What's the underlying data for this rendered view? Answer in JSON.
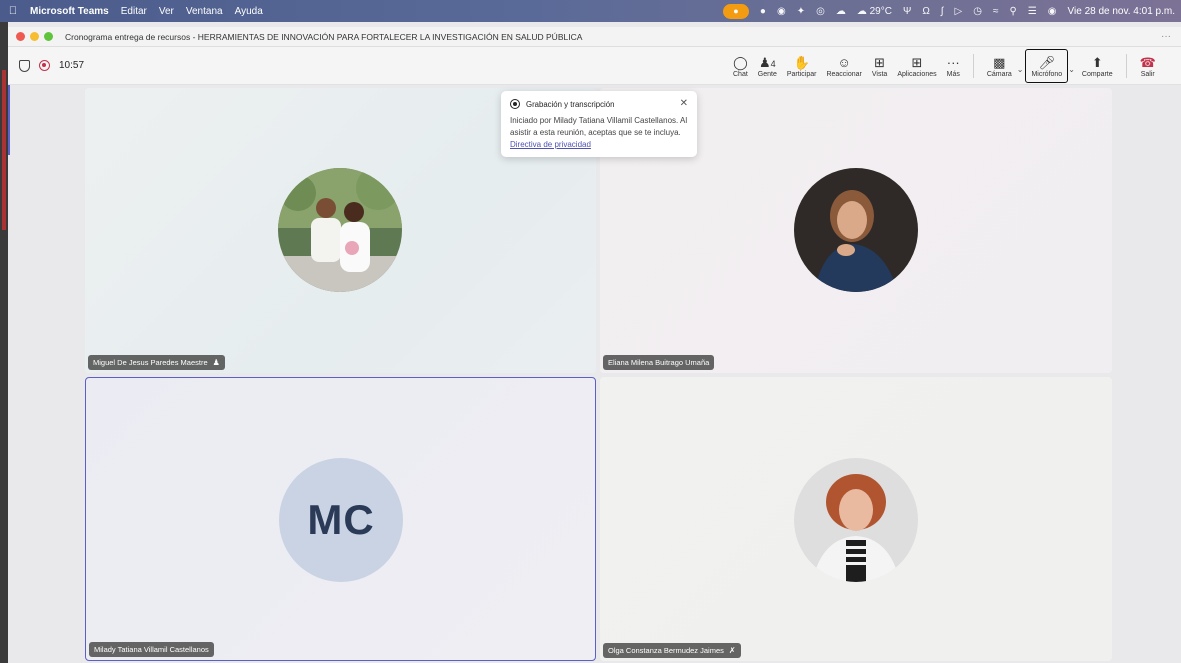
{
  "menubar": {
    "app": "Microsoft Teams",
    "items": [
      "Editar",
      "Ver",
      "Ventana",
      "Ayuda"
    ],
    "weather": "29°C",
    "datetime": "Vie 28 de nov.  4:01 p.m."
  },
  "window": {
    "title": "Cronograma entrega de recursos - HERRAMIENTAS DE INNOVACIÓN PARA FORTALECER LA INVESTIGACIÓN EN SALUD PÚBLICA"
  },
  "toolbar": {
    "timer": "10:57",
    "people_count": "4",
    "tools": [
      {
        "label": "Chat",
        "icon": "chat-icon"
      },
      {
        "label": "Gente",
        "icon": "people-icon"
      },
      {
        "label": "Participar",
        "icon": "raise-hand-icon"
      },
      {
        "label": "Reaccionar",
        "icon": "emoji-icon"
      },
      {
        "label": "Vista",
        "icon": "grid-view-icon"
      },
      {
        "label": "Aplicaciones",
        "icon": "apps-icon"
      },
      {
        "label": "Más",
        "icon": "more-icon"
      }
    ],
    "camera": "Cámara",
    "mic": "Micrófono",
    "share": "Comparte",
    "leave": "Salir"
  },
  "popup": {
    "title": "Grabación y transcripción",
    "body": "Iniciado por Milady Tatiana Villamil Castellanos. Al asistir a esta reunión, aceptas que se te incluya. ",
    "link": "Directiva de privacidad"
  },
  "participants": [
    {
      "name": "Miguel De Jesus Paredes Maestre",
      "badge": "people-icon"
    },
    {
      "name": "Eliana Milena Buitrago Umaña"
    },
    {
      "name": "Milady Tatiana Villamil Castellanos",
      "initials": "MC"
    },
    {
      "name": "Olga Constanza Bermudez Jaimes",
      "badge": "mic-off-icon"
    }
  ],
  "colors": {
    "accent": "#5b5fc7",
    "leave": "#c4314b",
    "recording": "#c4314b"
  }
}
